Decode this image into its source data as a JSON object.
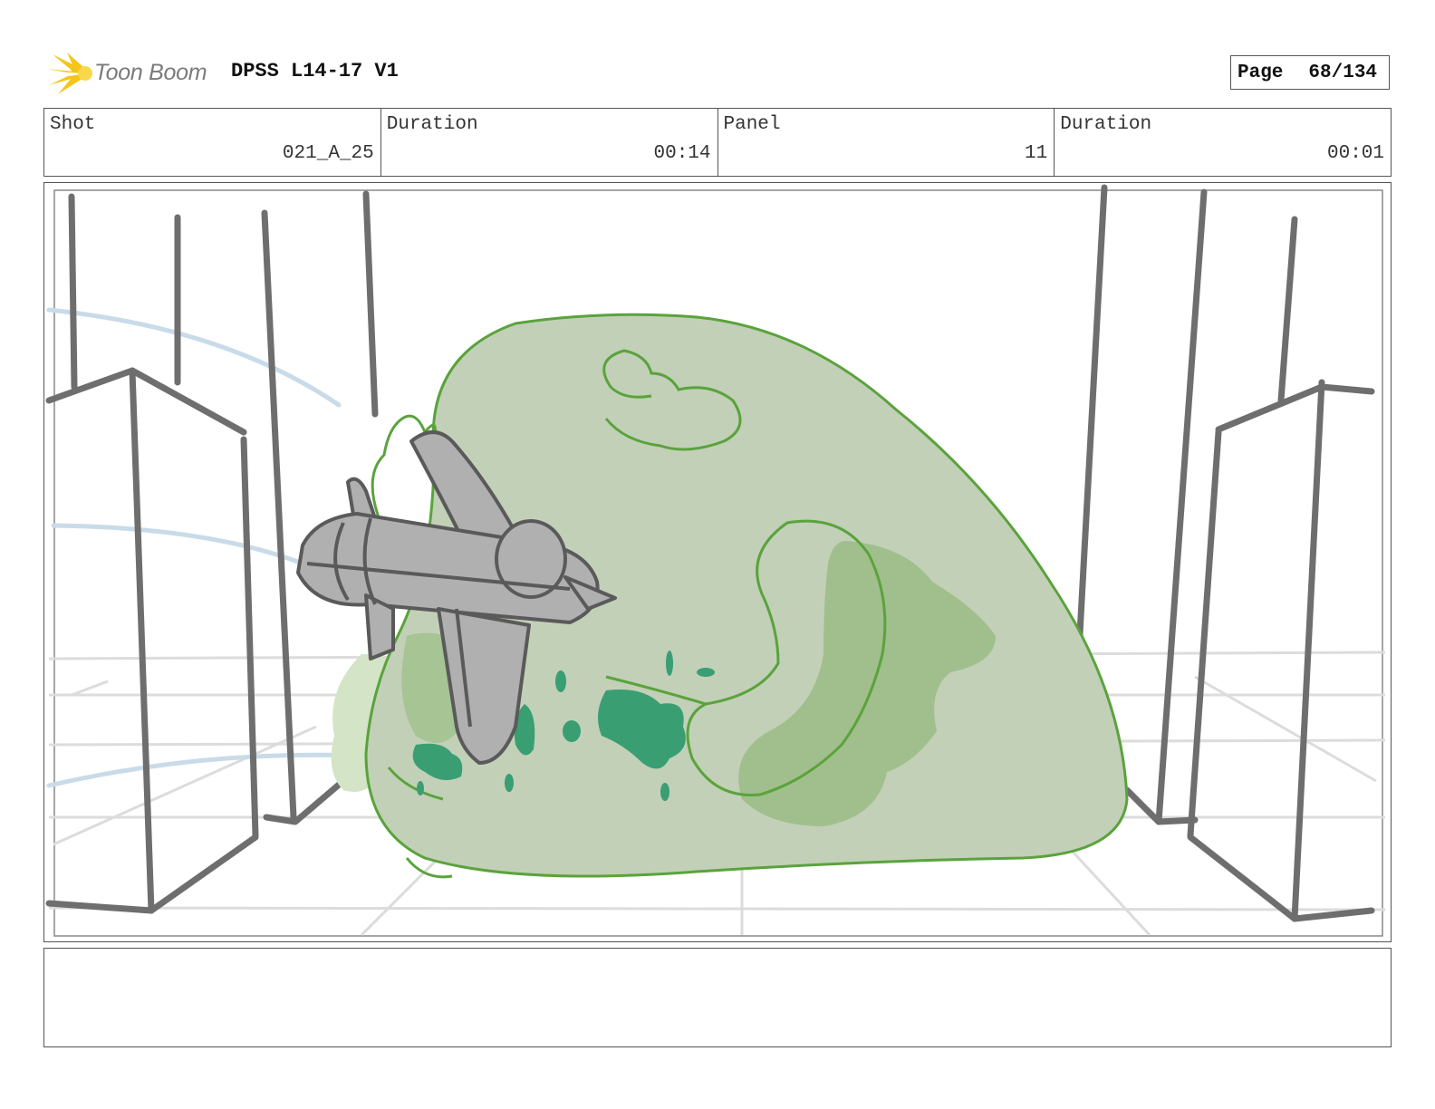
{
  "header": {
    "logo_text": "Toon Boom",
    "project_title": "DPSS L14-17 V1",
    "page_label": "Page",
    "page_number": "68/134"
  },
  "info": {
    "shot_label": "Shot",
    "shot_value": "021_A_25",
    "shot_duration_label": "Duration",
    "shot_duration_value": "00:14",
    "panel_label": "Panel",
    "panel_value": "11",
    "panel_duration_label": "Duration",
    "panel_duration_value": "00:01"
  },
  "colors": {
    "frame_border": "#555555",
    "logo_star": "#f5c518",
    "blob_fill": "#c2d0b8",
    "blob_outline": "#5aa33c",
    "plane_fill": "#b0b0b0",
    "splatter": "#3a9e73",
    "wind_lines": "#c9dbe8",
    "building_lines": "#6e6e6e"
  },
  "notes": {
    "action_text": ""
  }
}
